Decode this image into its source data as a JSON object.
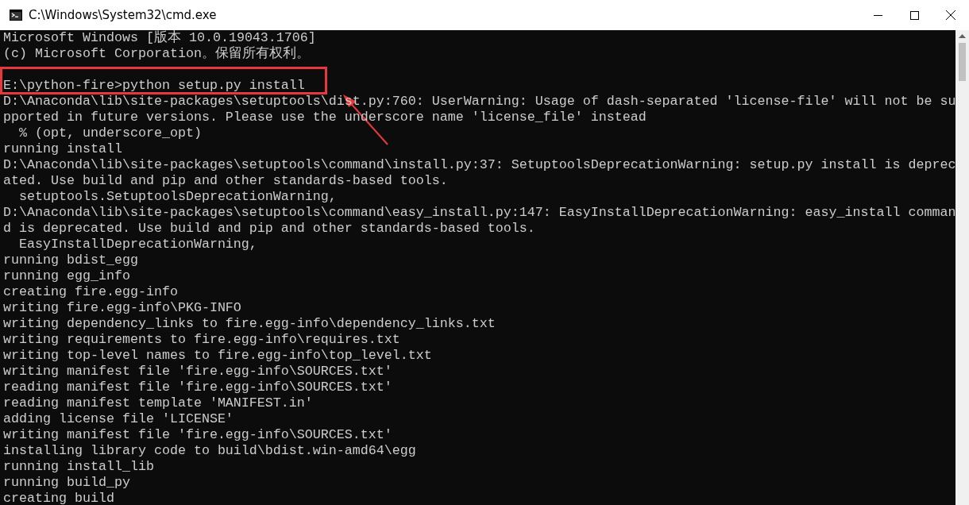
{
  "window": {
    "title": "C:\\Windows\\System32\\cmd.exe"
  },
  "lines": [
    {
      "kind": "text",
      "text": "Microsoft Windows [版本 10.0.19043.1706]",
      "highlighted": false
    },
    {
      "kind": "text",
      "text": "(c) Microsoft Corporation。保留所有权利。",
      "highlighted": false
    },
    {
      "kind": "blank"
    },
    {
      "kind": "text",
      "text": "E:\\python-fire>python setup.py install",
      "highlighted": true
    },
    {
      "kind": "text",
      "text": "D:\\Anaconda\\lib\\site-packages\\setuptools\\dist.py:760: UserWarning: Usage of dash-separated 'license-file' will not be su",
      "highlighted": false
    },
    {
      "kind": "text",
      "text": "pported in future versions. Please use the underscore name 'license_file' instead",
      "highlighted": false
    },
    {
      "kind": "text",
      "text": "  % (opt, underscore_opt)",
      "highlighted": false
    },
    {
      "kind": "text",
      "text": "running install",
      "highlighted": false
    },
    {
      "kind": "text",
      "text": "D:\\Anaconda\\lib\\site-packages\\setuptools\\command\\install.py:37: SetuptoolsDeprecationWarning: setup.py install is deprec",
      "highlighted": false
    },
    {
      "kind": "text",
      "text": "ated. Use build and pip and other standards-based tools.",
      "highlighted": false
    },
    {
      "kind": "text",
      "text": "  setuptools.SetuptoolsDeprecationWarning,",
      "highlighted": false
    },
    {
      "kind": "text",
      "text": "D:\\Anaconda\\lib\\site-packages\\setuptools\\command\\easy_install.py:147: EasyInstallDeprecationWarning: easy_install comman",
      "highlighted": false
    },
    {
      "kind": "text",
      "text": "d is deprecated. Use build and pip and other standards-based tools.",
      "highlighted": false
    },
    {
      "kind": "text",
      "text": "  EasyInstallDeprecationWarning,",
      "highlighted": false
    },
    {
      "kind": "text",
      "text": "running bdist_egg",
      "highlighted": false
    },
    {
      "kind": "text",
      "text": "running egg_info",
      "highlighted": false
    },
    {
      "kind": "text",
      "text": "creating fire.egg-info",
      "highlighted": false
    },
    {
      "kind": "text",
      "text": "writing fire.egg-info\\PKG-INFO",
      "highlighted": false
    },
    {
      "kind": "text",
      "text": "writing dependency_links to fire.egg-info\\dependency_links.txt",
      "highlighted": false
    },
    {
      "kind": "text",
      "text": "writing requirements to fire.egg-info\\requires.txt",
      "highlighted": false
    },
    {
      "kind": "text",
      "text": "writing top-level names to fire.egg-info\\top_level.txt",
      "highlighted": false
    },
    {
      "kind": "text",
      "text": "writing manifest file 'fire.egg-info\\SOURCES.txt'",
      "highlighted": false
    },
    {
      "kind": "text",
      "text": "reading manifest file 'fire.egg-info\\SOURCES.txt'",
      "highlighted": false
    },
    {
      "kind": "text",
      "text": "reading manifest template 'MANIFEST.in'",
      "highlighted": false
    },
    {
      "kind": "text",
      "text": "adding license file 'LICENSE'",
      "highlighted": false
    },
    {
      "kind": "text",
      "text": "writing manifest file 'fire.egg-info\\SOURCES.txt'",
      "highlighted": false
    },
    {
      "kind": "text",
      "text": "installing library code to build\\bdist.win-amd64\\egg",
      "highlighted": false
    },
    {
      "kind": "text",
      "text": "running install_lib",
      "highlighted": false
    },
    {
      "kind": "text",
      "text": "running build_py",
      "highlighted": false
    },
    {
      "kind": "text",
      "text": "creating build",
      "highlighted": false
    }
  ]
}
